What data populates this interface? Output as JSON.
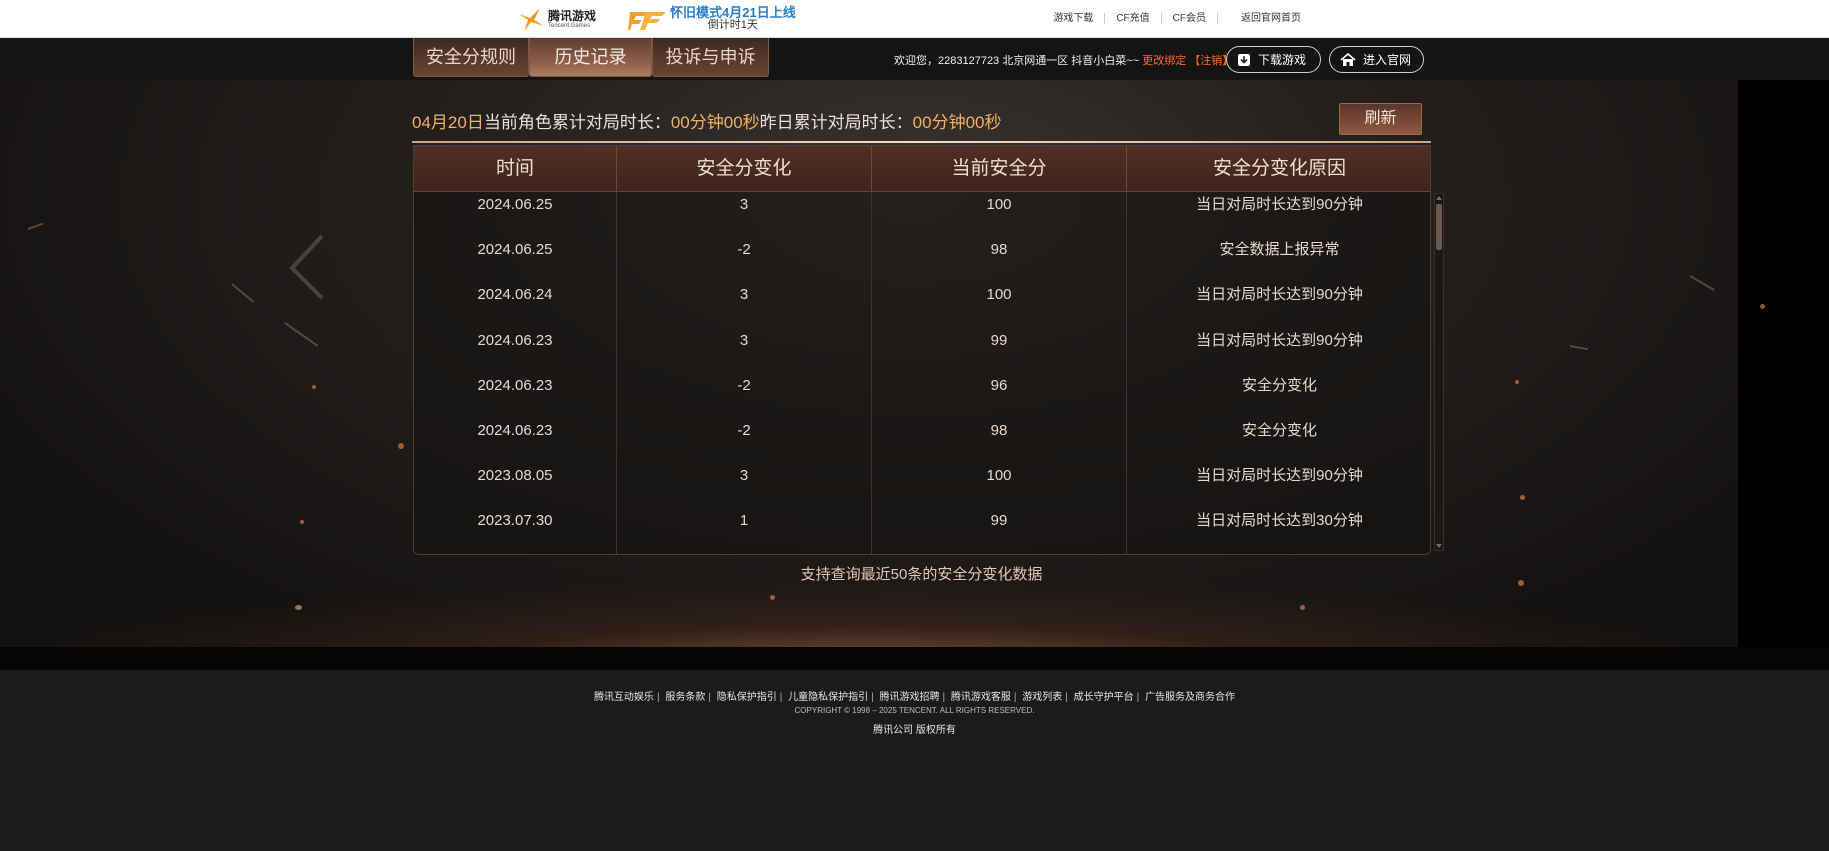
{
  "topbar": {
    "tencent_games_cn": "腾讯游戏",
    "tencent_games_en": "Tencent Games",
    "promo_line1": "怀旧模式4月21日上线",
    "promo_line2": "倒计时1天",
    "links": [
      "游戏下载",
      "CF充值",
      "CF会员",
      "返回官网首页"
    ]
  },
  "nav": {
    "tabs": [
      "安全分规则",
      "历史记录",
      "投诉与申诉"
    ],
    "active_tab_index": 1,
    "welcome_prefix": "欢迎您，2283127723 北京网通一区 抖音小白菜~~",
    "change_bind": "更改绑定",
    "logout": "【注销】",
    "download_button": "下载游戏",
    "official_button": "进入官网"
  },
  "summary": {
    "date": "04月20日",
    "today_label": "当前角色累计对局时长：",
    "today_value": "00分钟00秒",
    "yesterday_label": "昨日累计对局时长：",
    "yesterday_value": "00分钟00秒",
    "refresh_button": "刷新"
  },
  "table": {
    "headers": [
      "时间",
      "安全分变化",
      "当前安全分",
      "安全分变化原因"
    ],
    "rows": [
      [
        "2024.06.25",
        "3",
        "100",
        "当日对局时长达到90分钟"
      ],
      [
        "2024.06.25",
        "-2",
        "98",
        "安全数据上报异常"
      ],
      [
        "2024.06.24",
        "3",
        "100",
        "当日对局时长达到90分钟"
      ],
      [
        "2024.06.23",
        "3",
        "99",
        "当日对局时长达到90分钟"
      ],
      [
        "2024.06.23",
        "-2",
        "96",
        "安全分变化"
      ],
      [
        "2024.06.23",
        "-2",
        "98",
        "安全分变化"
      ],
      [
        "2023.08.05",
        "3",
        "100",
        "当日对局时长达到90分钟"
      ],
      [
        "2023.07.30",
        "1",
        "99",
        "当日对局时长达到30分钟"
      ]
    ],
    "note": "支持查询最近50条的安全分变化数据"
  },
  "footer": {
    "links": [
      "腾讯互动娱乐",
      "服务条款",
      "隐私保护指引",
      "儿童隐私保护指引",
      "腾讯游戏招聘",
      "腾讯游戏客服",
      "游戏列表",
      "成长守护平台",
      "广告服务及商务合作"
    ],
    "copyright": "COPYRIGHT © 1998 – 2025 TENCENT. ALL RIGHTS RESERVED.",
    "rights": "腾讯公司 版权所有"
  },
  "colors": {
    "accent_gold": "#f4b064",
    "warn_orange": "#ff6a24",
    "header_brown": "#512f24"
  }
}
